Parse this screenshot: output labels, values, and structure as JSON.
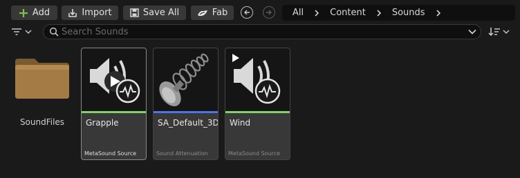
{
  "toolbar": {
    "add_label": "Add",
    "import_label": "Import",
    "save_all_label": "Save All",
    "fab_label": "Fab"
  },
  "breadcrumb": [
    "All",
    "Content",
    "Sounds"
  ],
  "search": {
    "placeholder": "Search Sounds",
    "value": ""
  },
  "colors": {
    "add_accent": "#7fc04a",
    "metasound_strip": "#7fd46a",
    "attenuation_strip": "#4f74e8",
    "folder": "#a57b45"
  },
  "folder": {
    "label": "SoundFiles",
    "icon": "folder-icon"
  },
  "assets": [
    {
      "name": "Grapple",
      "type": "MetaSound Source",
      "icon": "metasound-icon",
      "selected": true
    },
    {
      "name": "SA_Default_3D",
      "type": "Sound Attenuation",
      "icon": "sound-attenuation-icon",
      "selected": false
    },
    {
      "name": "Wind",
      "type": "MetaSound Source",
      "icon": "metasound-icon",
      "selected": false
    }
  ]
}
